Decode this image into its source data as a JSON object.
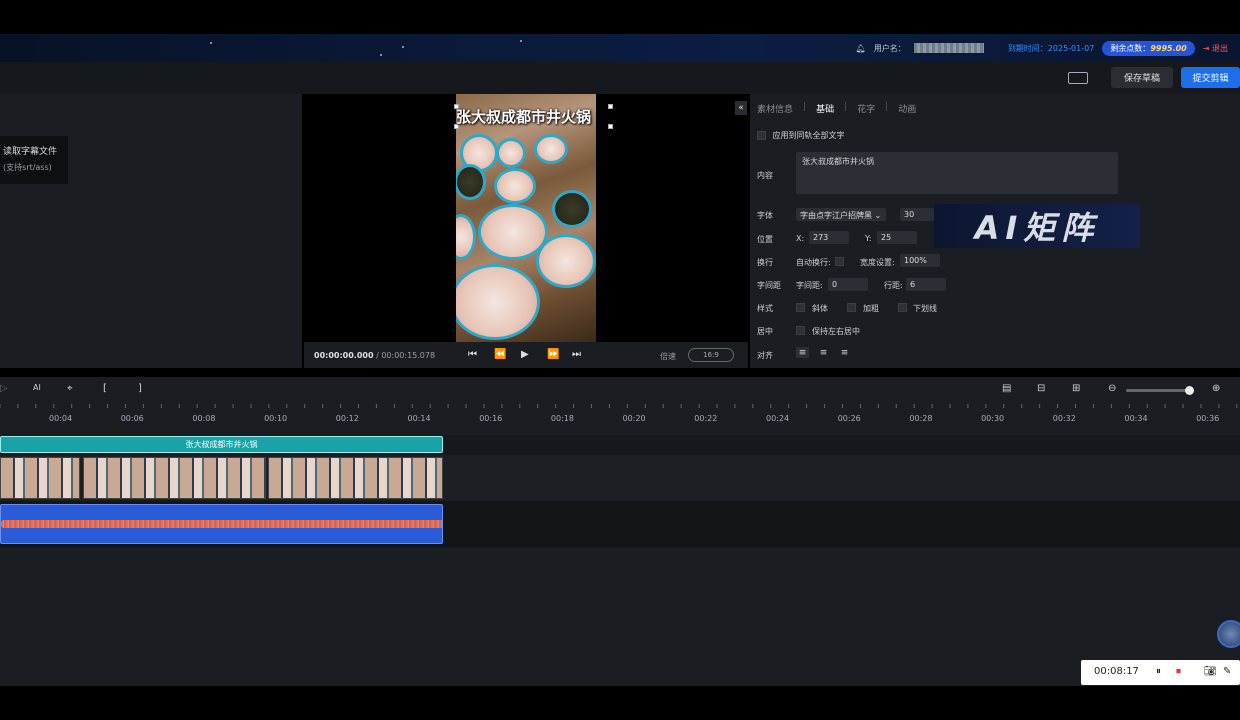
{
  "header": {
    "username_label": "用户名：",
    "expire_label": "到期时间：2025-01-07",
    "points_label": "剩余点数：",
    "points_value": "9995.00",
    "logout": "退出"
  },
  "actions": {
    "save": "保存草稿",
    "submit": "提交剪辑"
  },
  "left_panel": {
    "read_subtitle": "读取字幕文件",
    "support": "(支持srt/ass)"
  },
  "preview": {
    "overlay_title": "张大叔成都市井火锅",
    "time_current": "00:00:00.000",
    "time_total": " / 00:00:15.078",
    "speed_label": "倍速",
    "ratio": "16:9"
  },
  "props": {
    "tabs": [
      "素材信息",
      "基础",
      "花字",
      "动画"
    ],
    "active_tab": 1,
    "apply_all": "应用到同轨全部文字",
    "content_label": "内容",
    "content_value": "张大叔成都市井火锅",
    "font_label": "字体",
    "font_value": "字由点字江户招牌黑",
    "font_size": "30",
    "position_label": "位置",
    "x_label": "X:",
    "x_value": "273",
    "y_label": "Y:",
    "y_value": "25",
    "wrap_label": "换行",
    "auto_wrap": "自动换行:",
    "width_setting": "宽度设置:",
    "width_value": "100%",
    "spacing_label": "字间距",
    "char_spacing": "字间距:",
    "char_spacing_value": "0",
    "line_spacing": "行距:",
    "line_spacing_value": "6",
    "style_label": "样式",
    "italic": "斜体",
    "bold": "加粗",
    "underline": "下划线",
    "center_label": "居中",
    "keep_center": "保持左右居中",
    "align_label": "对齐"
  },
  "watermark": "AI矩阵",
  "timeline": {
    "ticks": [
      "00:04",
      "00:06",
      "00:08",
      "00:10",
      "00:12",
      "00:14",
      "00:16",
      "00:18",
      "00:20",
      "00:22",
      "00:24",
      "00:26",
      "00:28",
      "00:30",
      "00:32",
      "00:34",
      "00:36"
    ],
    "text_clip": "张大叔成都市井火锅"
  },
  "recorder": {
    "time": "00:08:17"
  },
  "colors": {
    "accent": "#1c6fe8",
    "text_clip": "#1aa3a6",
    "audio_clip": "#2a5bd8"
  }
}
